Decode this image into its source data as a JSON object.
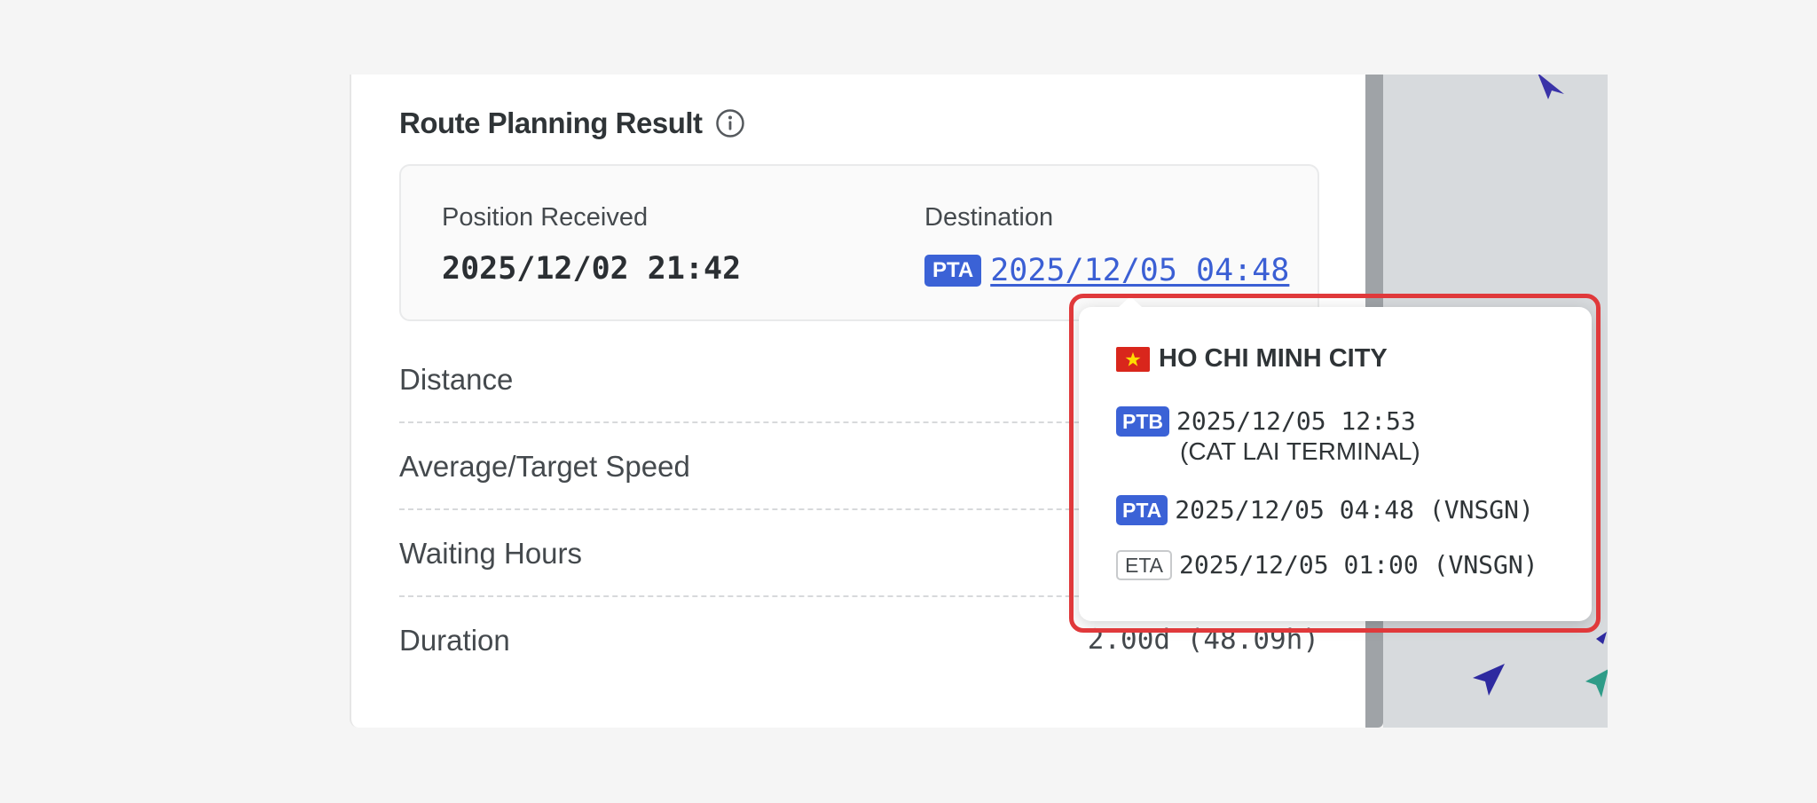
{
  "panel": {
    "title": "Route Planning Result",
    "summary": {
      "position_label": "Position Received",
      "position_value": "2025/12/02 21:42",
      "destination_label": "Destination",
      "destination_badge": "PTA",
      "destination_value": "2025/12/05 04:48"
    },
    "rows": [
      {
        "label": "Distance",
        "value": ""
      },
      {
        "label": "Average/Target Speed",
        "value": ""
      },
      {
        "label": "Waiting Hours",
        "value": ""
      },
      {
        "label": "Duration",
        "value": "2.00d (48.09h)"
      }
    ]
  },
  "popover": {
    "port_name": "HO CHI MINH CITY",
    "flag_icon": "vietnam-flag-icon",
    "entries": [
      {
        "badge": "PTB",
        "text": "2025/12/05 12:53",
        "sub": "(CAT LAI TERMINAL)"
      },
      {
        "badge": "PTA",
        "text": "2025/12/05 04:48 (VNSGN)"
      },
      {
        "badge": "ETA",
        "text": "2025/12/05 01:00 (VNSGN)"
      }
    ]
  },
  "colors": {
    "accent_blue": "#3b62d6",
    "link_blue": "#3b5fd4",
    "highlight_red": "#e0393b",
    "flag_red": "#d9261c",
    "flag_star": "#ffdd00"
  }
}
